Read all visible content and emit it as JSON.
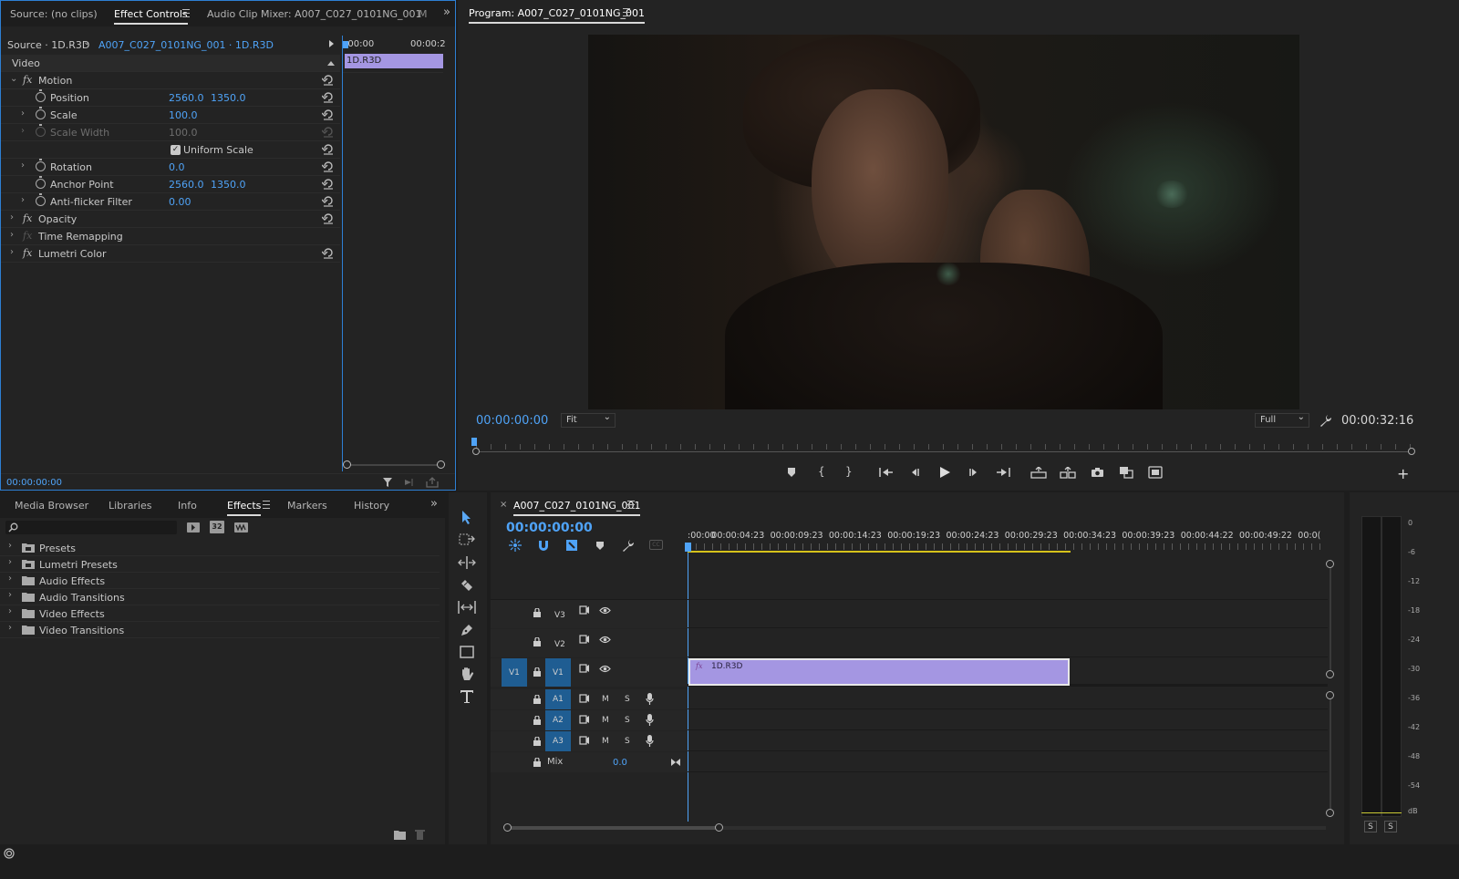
{
  "effect_panel": {
    "tabs": [
      "Source: (no clips)",
      "Effect Controls",
      "Audio Clip Mixer: A007_C027_0101NG_001",
      "M"
    ],
    "source_label": "Source · 1D.R3D",
    "clip_path": "A007_C027_0101NG_001 · 1D.R3D",
    "mini_ruler_start": ":00:00",
    "mini_ruler_end": "00:00:2",
    "mini_clip_label": "1D.R3D",
    "section_video": "Video",
    "rows": {
      "motion": "Motion",
      "position": "Position",
      "position_x": "2560.0",
      "position_y": "1350.0",
      "scale": "Scale",
      "scale_val": "100.0",
      "scale_width": "Scale Width",
      "scale_width_val": "100.0",
      "uniform_scale": "Uniform Scale",
      "rotation": "Rotation",
      "rotation_val": "0.0",
      "anchor_point": "Anchor Point",
      "anchor_x": "2560.0",
      "anchor_y": "1350.0",
      "anti_flicker": "Anti-flicker Filter",
      "anti_flicker_val": "0.00",
      "opacity": "Opacity",
      "time_remapping": "Time Remapping",
      "lumetri_color": "Lumetri Color"
    },
    "fx_glyph": "fx",
    "footer_time": "00:00:00:00"
  },
  "program": {
    "title": "Program: A007_C027_0101NG_001",
    "timecode": "00:00:00:00",
    "fit_select": "Fit",
    "quality_select": "Full",
    "duration": "00:00:32:16"
  },
  "effects_panel": {
    "tabs": [
      "Media Browser",
      "Libraries",
      "Info",
      "Effects",
      "Markers",
      "History"
    ],
    "search_placeholder": "",
    "badge_32": "32",
    "folders": [
      "Presets",
      "Lumetri Presets",
      "Audio Effects",
      "Audio Transitions",
      "Video Effects",
      "Video Transitions"
    ]
  },
  "timeline": {
    "sequence_name": "A007_C027_0101NG_001",
    "timecode": "00:00:00:00",
    "ruler": [
      ":00:00",
      "00:00:04:23",
      "00:00:09:23",
      "00:00:14:23",
      "00:00:19:23",
      "00:00:24:23",
      "00:00:29:23",
      "00:00:34:23",
      "00:00:39:23",
      "00:00:44:22",
      "00:00:49:22",
      "00:0("
    ],
    "video_tracks": [
      "V3",
      "V2",
      "V1"
    ],
    "source_patch": "V1",
    "audio_tracks": [
      "A1",
      "A2",
      "A3"
    ],
    "mute": "M",
    "solo": "S",
    "mix_label": "Mix",
    "mix_value": "0.0",
    "clip_label": "1D.R3D",
    "clip_fx": "fx"
  },
  "meter": {
    "scale": [
      "0",
      "-6",
      "-12",
      "-18",
      "-24",
      "-30",
      "-36",
      "-42",
      "-48",
      "-54",
      "dB"
    ],
    "solo_left": "S",
    "solo_right": "S"
  },
  "colors": {
    "accent_blue": "#4fa3f7",
    "clip_purple": "#a496e2",
    "panel_bg": "#232323",
    "app_bg": "#1d1d1d",
    "track_blue": "#1f5d92"
  }
}
